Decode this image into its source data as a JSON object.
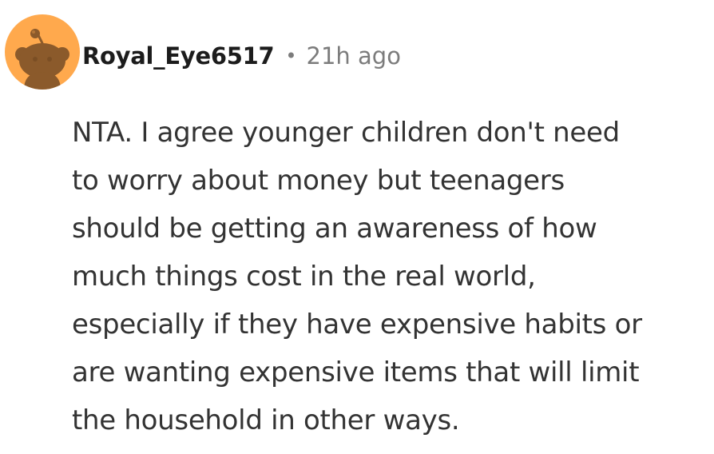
{
  "comment": {
    "username": "Royal_Eye6517",
    "separator": "•",
    "timestamp": "21h ago",
    "body_lines": [
      "NTA. I agree younger children don't need",
      "to worry about money but teenagers",
      "should be getting an awareness of how",
      "much things cost in the real world,",
      "especially if they have expensive habits or",
      "are wanting expensive items that will limit",
      "the household in other ways."
    ]
  },
  "colors": {
    "avatar_background": "#FFA94D",
    "avatar_figure": "#8B5A2B",
    "username_text": "#1c1c1c",
    "meta_text": "#7c7c7c",
    "body_text": "#333333"
  },
  "icons": {
    "avatar": "reddit-snoo-avatar-icon"
  }
}
